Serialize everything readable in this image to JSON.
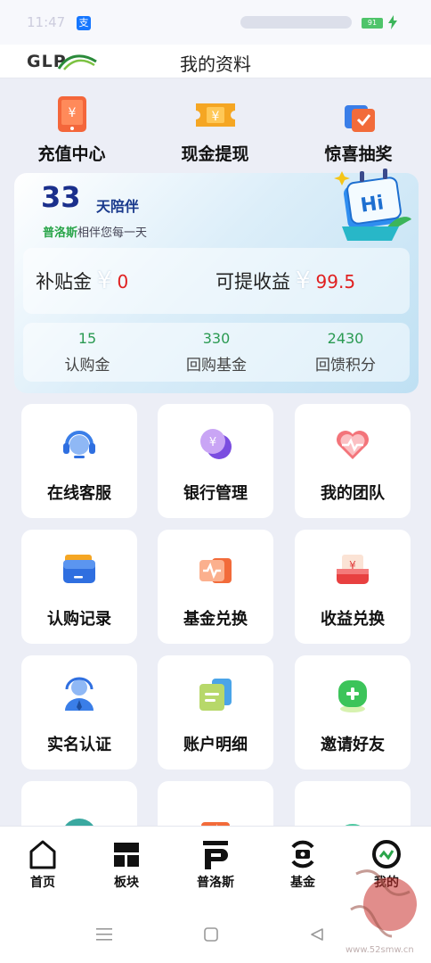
{
  "status_bar": {
    "time": "11:47",
    "battery": "91",
    "alipay_glyph": "支"
  },
  "header": {
    "logo": "GLP",
    "title": "我的资料"
  },
  "quick_actions": [
    {
      "label": "充值中心",
      "icon": "recharge-phone-icon",
      "color": "#f4663a"
    },
    {
      "label": "现金提现",
      "icon": "cash-ticket-icon",
      "color": "#f5a623"
    },
    {
      "label": "惊喜抽奖",
      "icon": "lottery-box-icon",
      "color": "#f26b3a"
    }
  ],
  "stats": {
    "days": "33",
    "days_unit": "天陪伴",
    "brand": "普洛斯",
    "tagline_rest": "相伴您每一天",
    "hi_text": "Hi",
    "subsidy_label": "补贴金",
    "subsidy_value": "0",
    "withdrawable_label": "可提收益",
    "withdrawable_value": "99.5",
    "currency_symbol": "¥",
    "metrics": [
      {
        "value": "15",
        "label": "认购金"
      },
      {
        "value": "330",
        "label": "回购基金"
      },
      {
        "value": "2430",
        "label": "回馈积分"
      }
    ]
  },
  "menu_tiles": [
    {
      "label": "在线客服",
      "icon": "customer-service-headset-icon"
    },
    {
      "label": "银行管理",
      "icon": "bank-coin-icon"
    },
    {
      "label": "我的团队",
      "icon": "team-heart-icon"
    },
    {
      "label": "认购记录",
      "icon": "subscription-wallet-icon"
    },
    {
      "label": "基金兑换",
      "icon": "fund-exchange-icon"
    },
    {
      "label": "收益兑换",
      "icon": "earnings-exchange-icon"
    },
    {
      "label": "实名认证",
      "icon": "real-name-person-icon"
    },
    {
      "label": "账户明细",
      "icon": "account-details-icon"
    },
    {
      "label": "邀请好友",
      "icon": "invite-friends-icon"
    },
    {
      "label": "",
      "icon": "help-question-icon"
    },
    {
      "label": "",
      "icon": "lightning-icon"
    },
    {
      "label": "",
      "icon": "chat-bubble-icon"
    }
  ],
  "tab_bar": [
    {
      "label": "首页",
      "icon": "home-icon"
    },
    {
      "label": "板块",
      "icon": "blocks-icon"
    },
    {
      "label": "普洛斯",
      "icon": "brand-p-icon"
    },
    {
      "label": "基金",
      "icon": "fund-icon"
    },
    {
      "label": "我的",
      "icon": "profile-ring-icon"
    }
  ],
  "watermark": {
    "site": "www.52smw.cn"
  },
  "colors": {
    "accent_green": "#2aa54a",
    "value_red": "#e02020",
    "days_blue": "#1a2f8c",
    "page_bg": "#eceef6"
  }
}
